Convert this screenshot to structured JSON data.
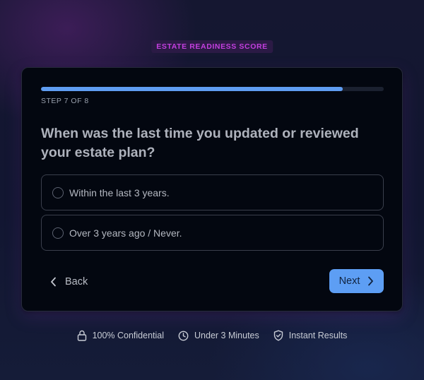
{
  "badge": {
    "label": "ESTATE READINESS SCORE"
  },
  "progress": {
    "step_text": "STEP 7 OF 8",
    "fraction": 0.88
  },
  "question": {
    "text": "When was the last time you updated or reviewed your estate plan?"
  },
  "options": [
    {
      "label": "Within the last 3 years."
    },
    {
      "label": "Over 3 years ago / Never."
    }
  ],
  "nav": {
    "back_label": "Back",
    "next_label": "Next"
  },
  "trust": [
    {
      "label": "100% Confidential",
      "icon": "lock-icon"
    },
    {
      "label": "Under 3 Minutes",
      "icon": "clock-icon"
    },
    {
      "label": "Instant Results",
      "icon": "shield-check-icon"
    }
  ],
  "colors": {
    "accent": "#5d9ef4",
    "badge_text": "#c43fe0",
    "card_bg": "#030710"
  }
}
